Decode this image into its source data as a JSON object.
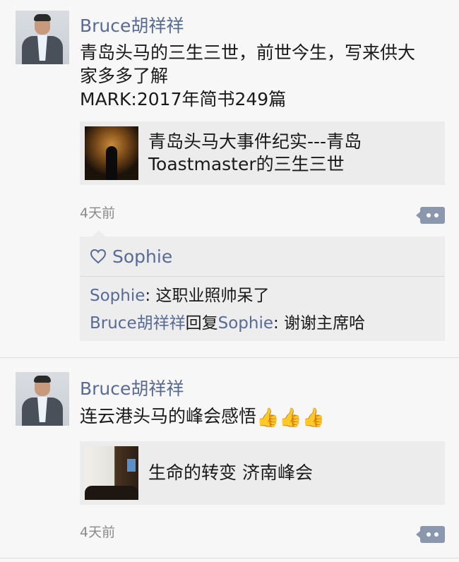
{
  "posts": [
    {
      "author": "Bruce胡祥祥",
      "content_lines": [
        "青岛头马的三生三世，前世今生，写来供大",
        "家多多了解",
        "MARK:2017年简书249篇"
      ],
      "link": {
        "title_lines": [
          "青岛头马大事件纪实---青岛",
          "Toastmaster的三生三世"
        ]
      },
      "time": "4天前",
      "likes": [
        "Sophie"
      ],
      "comments": [
        {
          "author": "Sophie",
          "separator": ": ",
          "text": "这职业照帅呆了"
        },
        {
          "author": "Bruce胡祥祥",
          "reply_word": "回复",
          "reply_to": "Sophie",
          "separator": ": ",
          "text": "谢谢主席哈"
        }
      ]
    },
    {
      "author": "Bruce胡祥祥",
      "content": "连云港头马的峰会感悟",
      "content_emoji": "👍👍👍",
      "link": {
        "title": "生命的转变 济南峰会"
      },
      "time": "4天前"
    }
  ],
  "icons": {
    "comment": "comment-bubble-icon",
    "like": "heart-icon",
    "emoji": "thumbs-up-icon"
  },
  "colors": {
    "name_link": "#576b95",
    "background": "#f7f7f7",
    "card": "#ececec",
    "comment_button": "#8a97ac"
  }
}
